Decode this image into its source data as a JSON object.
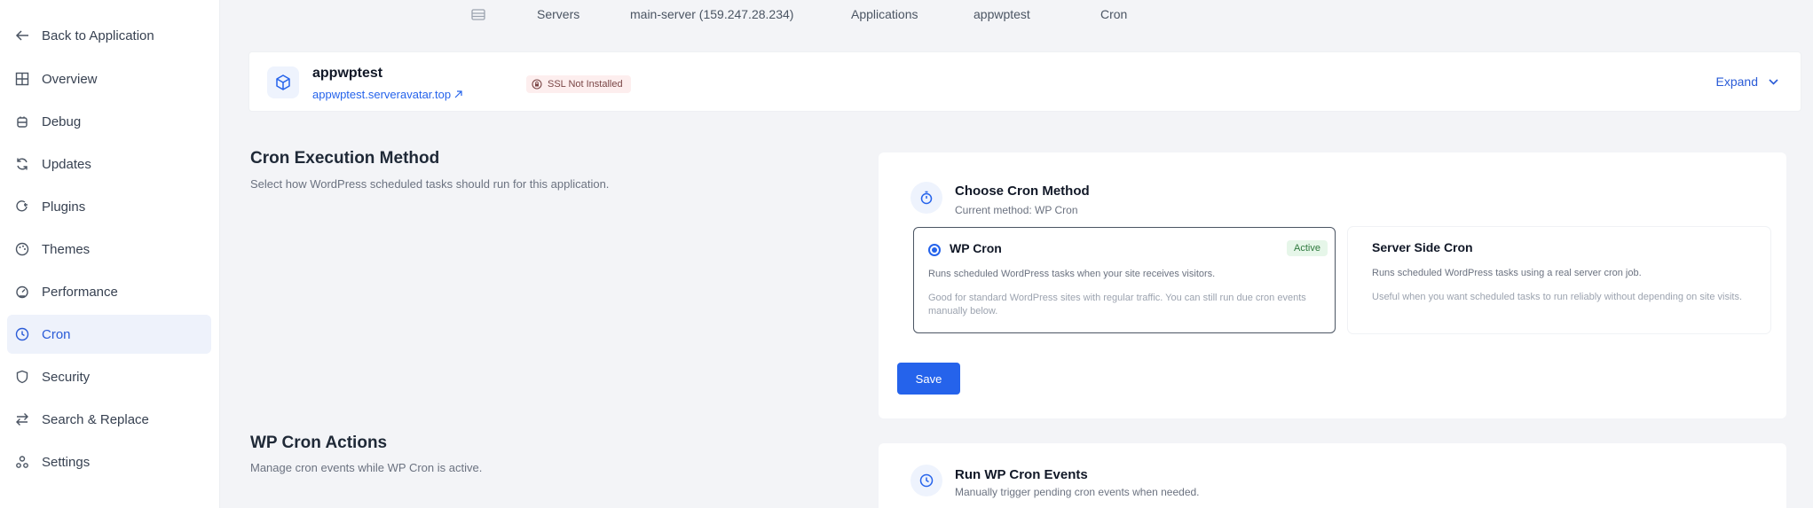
{
  "sidebar": {
    "back": "Back to Application",
    "items": [
      {
        "label": "Overview"
      },
      {
        "label": "Debug"
      },
      {
        "label": "Updates"
      },
      {
        "label": "Plugins"
      },
      {
        "label": "Themes"
      },
      {
        "label": "Performance"
      },
      {
        "label": "Cron"
      },
      {
        "label": "Security"
      },
      {
        "label": "Search & Replace"
      },
      {
        "label": "Settings"
      }
    ],
    "active": "Cron"
  },
  "breadcrumb": [
    "Servers",
    "main-server (159.247.28.234)",
    "Applications",
    "appwptest",
    "Cron"
  ],
  "app": {
    "name": "appwptest",
    "domain": "appwptest.serveravatar.top",
    "ssl_status": "SSL Not Installed",
    "expand_label": "Expand"
  },
  "cron_method": {
    "title": "Cron Execution Method",
    "description": "Select how WordPress scheduled tasks should run for this application.",
    "panel_title": "Choose Cron Method",
    "panel_subtitle": "Current method: WP Cron",
    "options": [
      {
        "title": "WP Cron",
        "badge": "Active",
        "description": "Runs scheduled WordPress tasks when your site receives visitors.",
        "note": "Good for standard WordPress sites with regular traffic. You can still run due cron events manually below."
      },
      {
        "title": "Server Side Cron",
        "description": "Runs scheduled WordPress tasks using a real server cron job.",
        "note": "Useful when you want scheduled tasks to run reliably without depending on site visits."
      }
    ],
    "save_label": "Save"
  },
  "cron_actions": {
    "title": "WP Cron Actions",
    "description": "Manage cron events while WP Cron is active.",
    "panel_title": "Run WP Cron Events",
    "panel_subtitle": "Manually trigger pending cron events when needed."
  },
  "colors": {
    "accent": "#2563eb",
    "active_nav_bg": "#eef2fb",
    "ssl_badge_bg": "#fdeeee",
    "active_badge_bg": "#e6f6e9"
  }
}
